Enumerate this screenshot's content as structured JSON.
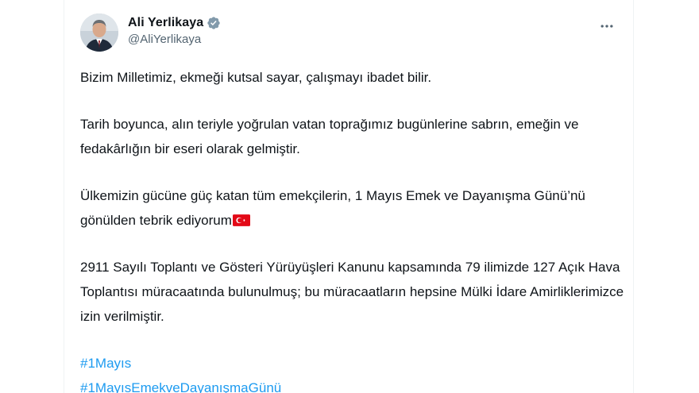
{
  "tweet": {
    "author": {
      "display_name": "Ali Yerlikaya",
      "handle": "@AliYerlikaya",
      "verified": true,
      "avatar_icon": "person-avatar"
    },
    "more_icon": "more-horizontal-icon",
    "paragraphs": [
      "Bizim Milletimiz, ekmeği kutsal sayar, çalışmayı ibadet bilir.",
      "Tarih boyunca, alın teriyle yoğrulan vatan toprağımız bugünlerine sabrın, emeğin ve fedakârlığın bir eseri olarak gelmiştir.",
      "Ülkemizin gücüne güç katan tüm emekçilerin, 1 Mayıs Emek ve Dayanışma Günü’nü gönülden tebrik ediyorum",
      "2911 Sayılı Toplantı ve Gösteri Yürüyüşleri Kanunu kapsamında 79 ilimizde 127 Açık Hava Toplantısı müracaatında bulunulmuş; bu müracaatların hepsine Mülki İdare Amirliklerimizce izin verilmiştir."
    ],
    "hashtags": [
      "#1Mayıs",
      "#1MayısEmekveDayanışmaGünü"
    ],
    "colors": {
      "text": "#0f1419",
      "secondary": "#536471",
      "link": "#1d9bf0",
      "verified": "#829aab",
      "flag_red": "#e30a17"
    }
  }
}
